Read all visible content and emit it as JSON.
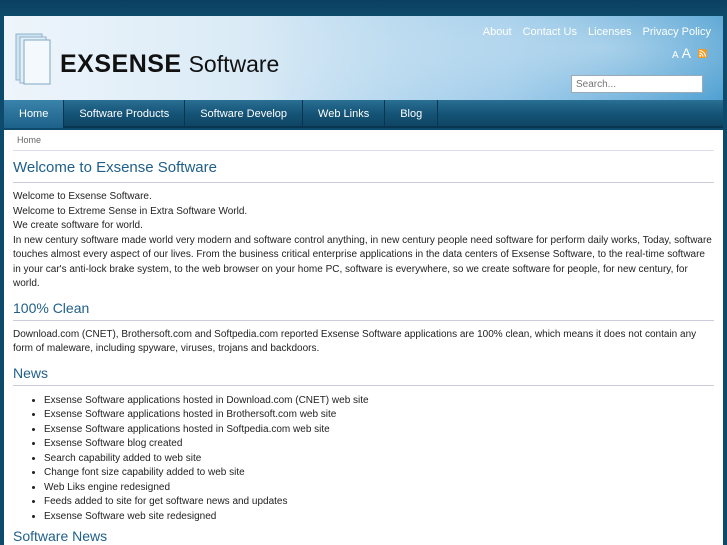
{
  "brand": {
    "name_bold": "EXSENSE",
    "name_rest": "Software"
  },
  "toplinks": [
    "About",
    "Contact Us",
    "Licenses",
    "Privacy Policy"
  ],
  "font_control": {
    "small": "A",
    "large": "A",
    "rss_icon": "rss-icon"
  },
  "search": {
    "placeholder": "Search..."
  },
  "nav": [
    "Home",
    "Software Products",
    "Software Develop",
    "Web Links",
    "Blog"
  ],
  "breadcrumb": "Home",
  "main": {
    "title": "Welcome to Exsense Software",
    "intro": [
      "Welcome to Exsense Software.",
      "Welcome to Extreme Sense in Extra Software World.",
      "We create software for world.",
      "In new century software made world very modern and software control anything, in new century people need software for perform daily works, Today, software touches almost every aspect of our lives. From the business critical enterprise applications in the data centers of Exsense Software, to the real-time software in your car's anti-lock brake system, to the web browser on your home PC, software is everywhere, so we create software for people, for new century, for world."
    ],
    "clean_title": "100% Clean",
    "clean_text": "Download.com (CNET), Brothersoft.com and Softpedia.com reported Exsense Software applications are 100% clean, which means it does not contain any form of maleware, including spyware, viruses, trojans and backdoors.",
    "news_title": "News",
    "news": [
      "Exsense Software applications hosted in Download.com (CNET) web site",
      "Exsense Software applications hosted in Brothersoft.com web site",
      "Exsense Software applications hosted in Softpedia.com web site",
      "Exsense Software blog created",
      "Search capability added to web site",
      "Change font size capability added to web site",
      "Web Liks engine redesigned",
      "Feeds added to site for get software news and updates",
      "Exsense Software web site redesigned"
    ],
    "next_title": "Software News"
  },
  "colors": {
    "heading": "#1f5f8b",
    "nav_bg": "#145375",
    "page_bg": "#0e4a6c"
  }
}
